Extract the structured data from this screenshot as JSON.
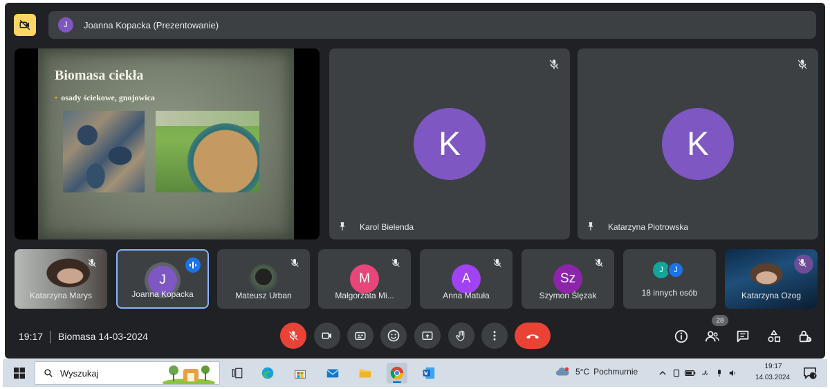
{
  "presenter": {
    "avatar": "J",
    "label": "Joanna Kopacka (Prezentowanie)"
  },
  "slide": {
    "title": "Biomasa ciekła",
    "bullet": "osady ściekowe, gnojowica"
  },
  "main_tiles": [
    {
      "avatar": "K",
      "name": "Karol Bielenda"
    },
    {
      "avatar": "K",
      "name": "Katarzyna Piotrowska"
    }
  ],
  "small_tiles": [
    {
      "name": "Katarzyna Marys",
      "type": "video"
    },
    {
      "name": "Joanna Kopacka",
      "avatar": "J",
      "color": "#7e57c2",
      "speaking": true
    },
    {
      "name": "Mateusz Urban",
      "type": "video-small"
    },
    {
      "name": "Małgorzata Mi...",
      "avatar": "M",
      "color": "#e8457a"
    },
    {
      "name": "Anna Matuła",
      "avatar": "A",
      "color": "#a142f4"
    },
    {
      "name": "Szymon Ślęzak",
      "avatar": "Sz",
      "color": "#8e24aa"
    },
    {
      "name": "18 innych osób",
      "avatars": [
        "J",
        "J"
      ]
    },
    {
      "name": "Katarzyna Ozog",
      "type": "video"
    }
  ],
  "meeting": {
    "time": "19:17",
    "name": "Biomasa 14-03-2024",
    "participants_count": "28"
  },
  "colors": {
    "background": "#202124",
    "tile": "#3c4043",
    "avatar": "#7e57c2",
    "red": "#ea4335",
    "accent": "#8ab4f8"
  },
  "taskbar": {
    "search_placeholder": "Wyszukaj",
    "weather_temp": "5°C",
    "weather_condition": "Pochmurnie",
    "time": "19:17",
    "date": "14.03.2024",
    "notification_count": "7"
  }
}
